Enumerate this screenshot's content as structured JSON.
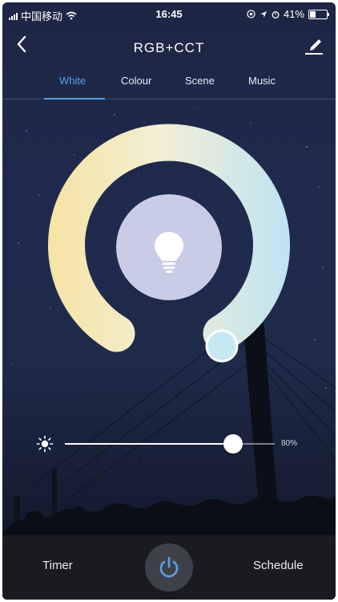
{
  "status_bar": {
    "carrier": "中国移动",
    "time": "16:45",
    "battery": "41%",
    "battery_level": 0.41
  },
  "header": {
    "title": "RGB+CCT"
  },
  "tabs": [
    {
      "label": "White",
      "active": true
    },
    {
      "label": "Colour",
      "active": false
    },
    {
      "label": "Scene",
      "active": false
    },
    {
      "label": "Music",
      "active": false
    }
  ],
  "brightness": {
    "label": "80%",
    "value": 0.8
  },
  "bottom_bar": {
    "timer": "Timer",
    "schedule": "Schedule"
  },
  "colors": {
    "accent": "#5ca0e6",
    "warm": "#f3e2a6",
    "cool": "#bfe3f3",
    "bulb_disc": "#c9cce6"
  },
  "icons": [
    "back-icon",
    "edit-icon",
    "bulb-icon",
    "sun-icon",
    "power-icon",
    "wifi-icon",
    "location-icon",
    "alarm-icon"
  ]
}
